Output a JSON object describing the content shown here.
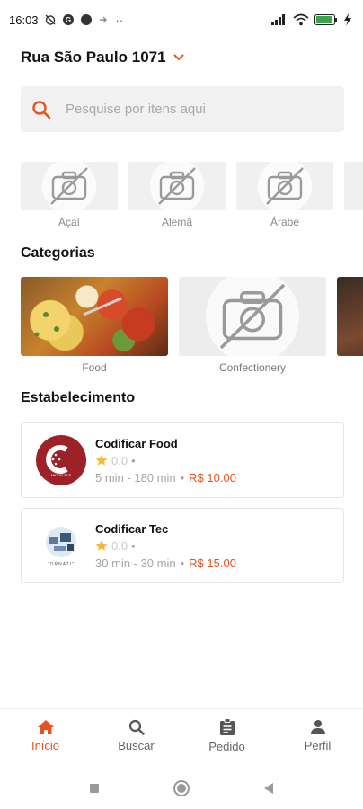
{
  "status_bar": {
    "time": "16:03",
    "dots": "··"
  },
  "header": {
    "address": "Rua São Paulo 1071"
  },
  "search": {
    "placeholder": "Pesquise por itens aqui"
  },
  "cuisines": [
    {
      "label": "Açaí"
    },
    {
      "label": "Alemã"
    },
    {
      "label": "Árabe"
    }
  ],
  "categories_section": {
    "title": "Categorias",
    "items": [
      {
        "label": "Food"
      },
      {
        "label": "Confectionery"
      },
      {
        "label": ""
      }
    ]
  },
  "establishments_section": {
    "title": "Estabelecimento",
    "items": [
      {
        "name": "Codificar Food",
        "rating": "0.0",
        "time": "5 min - 180 min",
        "price": "R$ 10.00",
        "logo_text": "MKT PLACE"
      },
      {
        "name": "Codificar Tec",
        "rating": "0.0",
        "time": "30 min - 30 min",
        "price": "R$ 15.00",
        "logo_text": "\"DRNATI\""
      }
    ]
  },
  "bottom_nav": [
    {
      "label": "Início",
      "icon": "home-icon",
      "active": true
    },
    {
      "label": "Buscar",
      "icon": "search-icon",
      "active": false
    },
    {
      "label": "Pedido",
      "icon": "clipboard-icon",
      "active": false
    },
    {
      "label": "Perfil",
      "icon": "person-icon",
      "active": false
    }
  ],
  "colors": {
    "accent": "#e8511d",
    "star": "#f6b93b",
    "logo_food_bg": "#9c2227"
  }
}
